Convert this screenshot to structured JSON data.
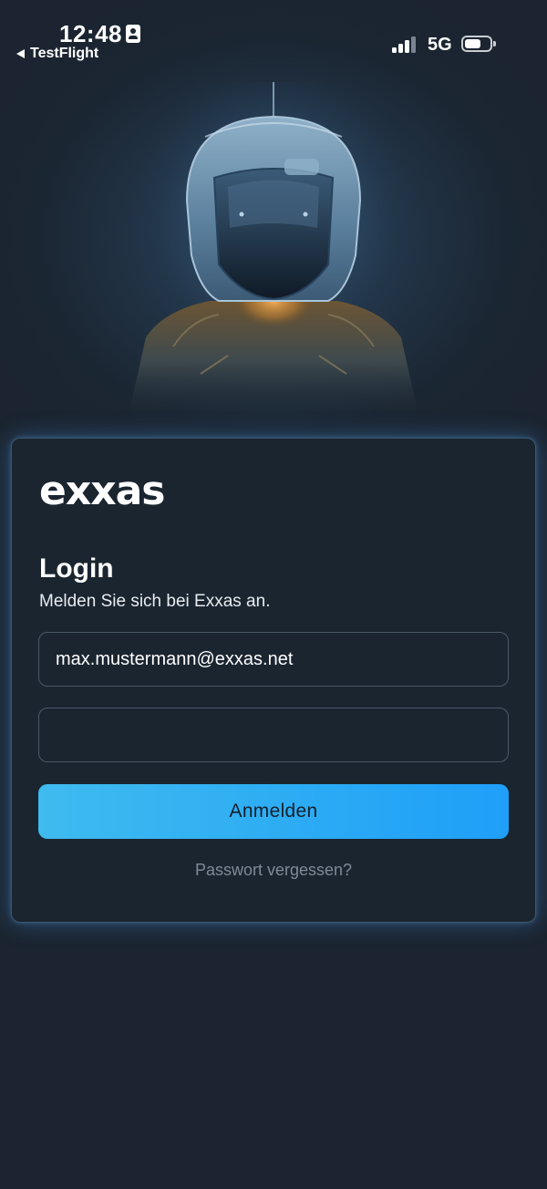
{
  "status_bar": {
    "time": "12:48",
    "back_app_label": "TestFlight",
    "network": "5G",
    "signal_bars_active": 3,
    "signal_bars_total": 4,
    "battery_level": 0.65,
    "icons": [
      "contact-card-icon",
      "back-caret-icon",
      "signal-icon",
      "battery-icon"
    ]
  },
  "hero": {
    "icon": "astronaut-illustration"
  },
  "login_card": {
    "brand": "exxas",
    "title": "Login",
    "subtitle": "Melden Sie sich bei Exxas an.",
    "email_value": "max.mustermann@exxas.net",
    "password_value": "",
    "submit_label": "Anmelden",
    "forgot_label": "Passwort vergessen?"
  },
  "colors": {
    "background": "#1b2430",
    "card": "#1a2530",
    "accent_button": "#2eadf3",
    "muted_text": "#7f8a96"
  }
}
